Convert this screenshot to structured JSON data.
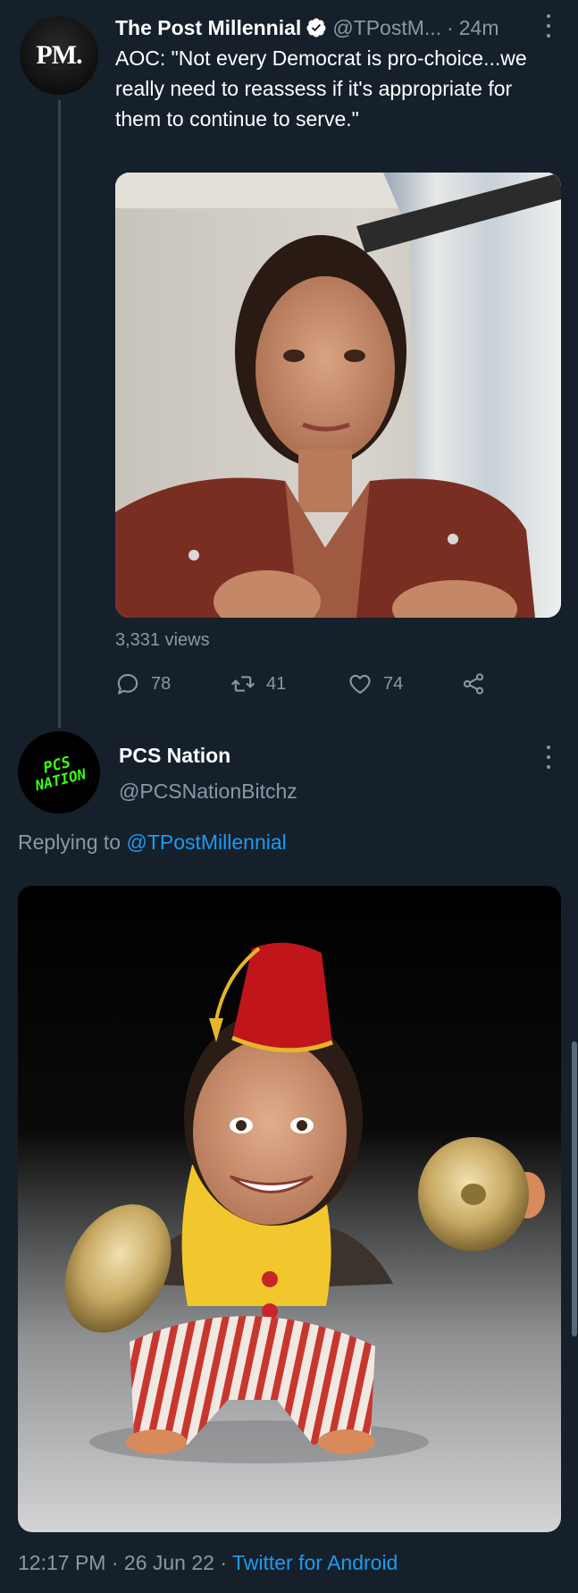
{
  "tweet1": {
    "avatar_text": "PM.",
    "name": "The Post Millennial",
    "handle": "@TPostM...",
    "separator": "·",
    "time": "24m",
    "text": "AOC: \"Not every Democrat is pro-choice...we really need to reassess if it's appropriate for them to continue to serve.\"",
    "media_kind": "video",
    "views": "3,331 views",
    "reply_count": "78",
    "retweet_count": "41",
    "like_count": "74"
  },
  "tweet2": {
    "avatar_line1": "PCS",
    "avatar_line2": "NATION",
    "name": "PCS Nation",
    "handle": "@PCSNationBitchz",
    "replying_prefix": "Replying to",
    "replying_handle": "@TPostMillennial",
    "media_kind": "image",
    "time": "12:17 PM",
    "separator": "·",
    "date": "26 Jun 22",
    "source": "Twitter for Android"
  },
  "colors": {
    "background": "#15202b",
    "text_primary": "#ffffff",
    "text_secondary": "#8899a6",
    "link": "#1d9bf0",
    "verified": "#1d9bf0",
    "avatar_logo_green": "#39ff14"
  },
  "icons": [
    "verified-badge-icon",
    "more-icon",
    "reply-icon",
    "retweet-icon",
    "like-icon",
    "share-icon"
  ]
}
